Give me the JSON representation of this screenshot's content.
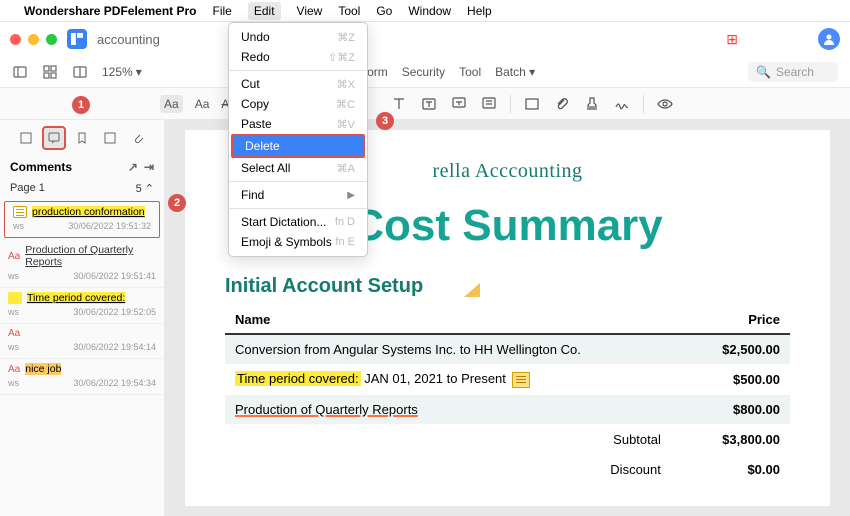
{
  "menubar": {
    "appname": "Wondershare PDFelement Pro",
    "items": [
      "File",
      "Edit",
      "View",
      "Tool",
      "Go",
      "Window",
      "Help"
    ],
    "active": "Edit"
  },
  "titlebar": {
    "doc": "accounting"
  },
  "toolbar": {
    "zoom": "125%",
    "tabs": [
      "Form",
      "Security",
      "Tool",
      "Batch"
    ],
    "search_placeholder": "Search"
  },
  "dropdown": {
    "undo": "Undo",
    "undo_sc": "⌘Z",
    "redo": "Redo",
    "redo_sc": "⇧⌘Z",
    "cut": "Cut",
    "cut_sc": "⌘X",
    "copy": "Copy",
    "copy_sc": "⌘C",
    "paste": "Paste",
    "paste_sc": "⌘V",
    "delete": "Delete",
    "selectall": "Select All",
    "selectall_sc": "⌘A",
    "find": "Find",
    "dictation": "Start Dictation...",
    "dictation_sc": "fn D",
    "emoji": "Emoji & Symbols",
    "emoji_sc": "fn E"
  },
  "sidebar": {
    "title": "Comments",
    "page_label": "Page 1",
    "page_count": "5",
    "items": [
      {
        "text": "production conformation",
        "user": "ws",
        "ts": "30/06/2022 19:51:32",
        "kind": "note-hl"
      },
      {
        "aa": "Aa",
        "text": "Production of Quarterly Reports",
        "user": "ws",
        "ts": "30/06/2022 19:51:41",
        "kind": "underline"
      },
      {
        "text": "Time period covered:",
        "user": "ws",
        "ts": "30/06/2022 19:52:05",
        "kind": "highlight"
      },
      {
        "aa": "Aa",
        "text": "",
        "user": "ws",
        "ts": "30/06/2022 19:54:14",
        "kind": "plain"
      },
      {
        "aa": "Aa",
        "text": "nice job",
        "user": "ws",
        "ts": "30/06/2022 19:54:34",
        "kind": "orange"
      }
    ]
  },
  "doc": {
    "brand": "rella Acccounting",
    "title": "Cost Summary",
    "section": "Initial Account Setup",
    "th_name": "Name",
    "th_price": "Price",
    "rows": [
      {
        "name": "Conversion from Angular Systems Inc. to HH Wellington Co.",
        "price": "$2,500.00"
      },
      {
        "name_hl": "Time period covered:",
        "name_rest": " JAN 01, 2021 to Present",
        "price": "$500.00",
        "note": true
      },
      {
        "name_und": "Production of Quarterly Reports",
        "price": "$800.00"
      }
    ],
    "subtotal_label": "Subtotal",
    "subtotal": "$3,800.00",
    "discount_label": "Discount",
    "discount": "$0.00"
  },
  "callouts": {
    "c1": "1",
    "c2": "2",
    "c3": "3"
  }
}
